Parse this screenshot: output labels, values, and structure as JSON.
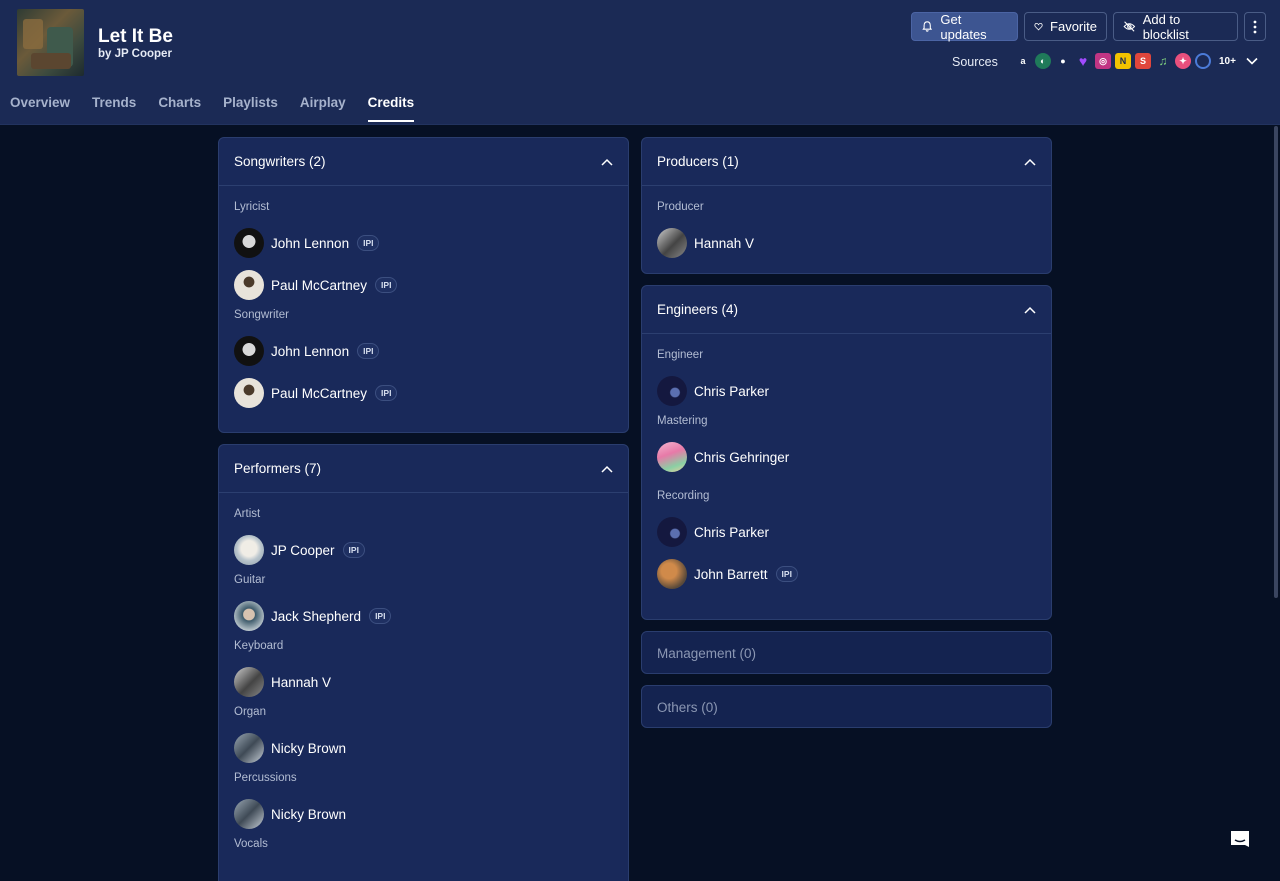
{
  "song": {
    "title": "Let It Be",
    "artist_line": "by JP Cooper"
  },
  "actions": {
    "get_updates": "Get updates",
    "favorite": "Favorite",
    "blocklist": "Add to blocklist"
  },
  "sources": {
    "label": "Sources",
    "icons": [
      "amazon-icon",
      "anghami-icon",
      "apple-icon",
      "deezer-icon",
      "instagram-icon",
      "napster-icon",
      "shazam-icon",
      "apple-music-icon",
      "itunes-icon",
      "pandora-icon"
    ],
    "more": "10+"
  },
  "tabs": [
    "Overview",
    "Trends",
    "Charts",
    "Playlists",
    "Airplay",
    "Credits"
  ],
  "active_tab": "Credits",
  "songwriters": {
    "title": "Songwriters (2)",
    "roles": [
      {
        "role": "Lyricist",
        "people": [
          {
            "name": "John Lennon",
            "ipi": "IPI"
          },
          {
            "name": "Paul McCartney",
            "ipi": "IPI"
          }
        ]
      },
      {
        "role": "Songwriter",
        "people": [
          {
            "name": "John Lennon",
            "ipi": "IPI"
          },
          {
            "name": "Paul McCartney",
            "ipi": "IPI"
          }
        ]
      }
    ]
  },
  "performers": {
    "title": "Performers (7)",
    "roles": [
      {
        "role": "Artist",
        "people": [
          {
            "name": "JP Cooper",
            "ipi": "IPI"
          }
        ]
      },
      {
        "role": "Guitar",
        "people": [
          {
            "name": "Jack Shepherd",
            "ipi": "IPI"
          }
        ]
      },
      {
        "role": "Keyboard",
        "people": [
          {
            "name": "Hannah V"
          }
        ]
      },
      {
        "role": "Organ",
        "people": [
          {
            "name": "Nicky Brown"
          }
        ]
      },
      {
        "role": "Percussions",
        "people": [
          {
            "name": "Nicky Brown"
          }
        ]
      },
      {
        "role": "Vocals"
      }
    ]
  },
  "producers": {
    "title": "Producers (1)",
    "roles": [
      {
        "role": "Producer",
        "people": [
          {
            "name": "Hannah V"
          }
        ]
      }
    ]
  },
  "engineers": {
    "title": "Engineers (4)",
    "roles": [
      {
        "role": "Engineer",
        "people": [
          {
            "name": "Chris Parker"
          }
        ]
      },
      {
        "role": "Mastering",
        "people": [
          {
            "name": "Chris Gehringer"
          }
        ]
      },
      {
        "role": "Recording",
        "people": [
          {
            "name": "Chris Parker"
          },
          {
            "name": "John Barrett",
            "ipi": "IPI"
          }
        ]
      }
    ]
  },
  "management": {
    "title": "Management (0)"
  },
  "others": {
    "title": "Others (0)"
  }
}
